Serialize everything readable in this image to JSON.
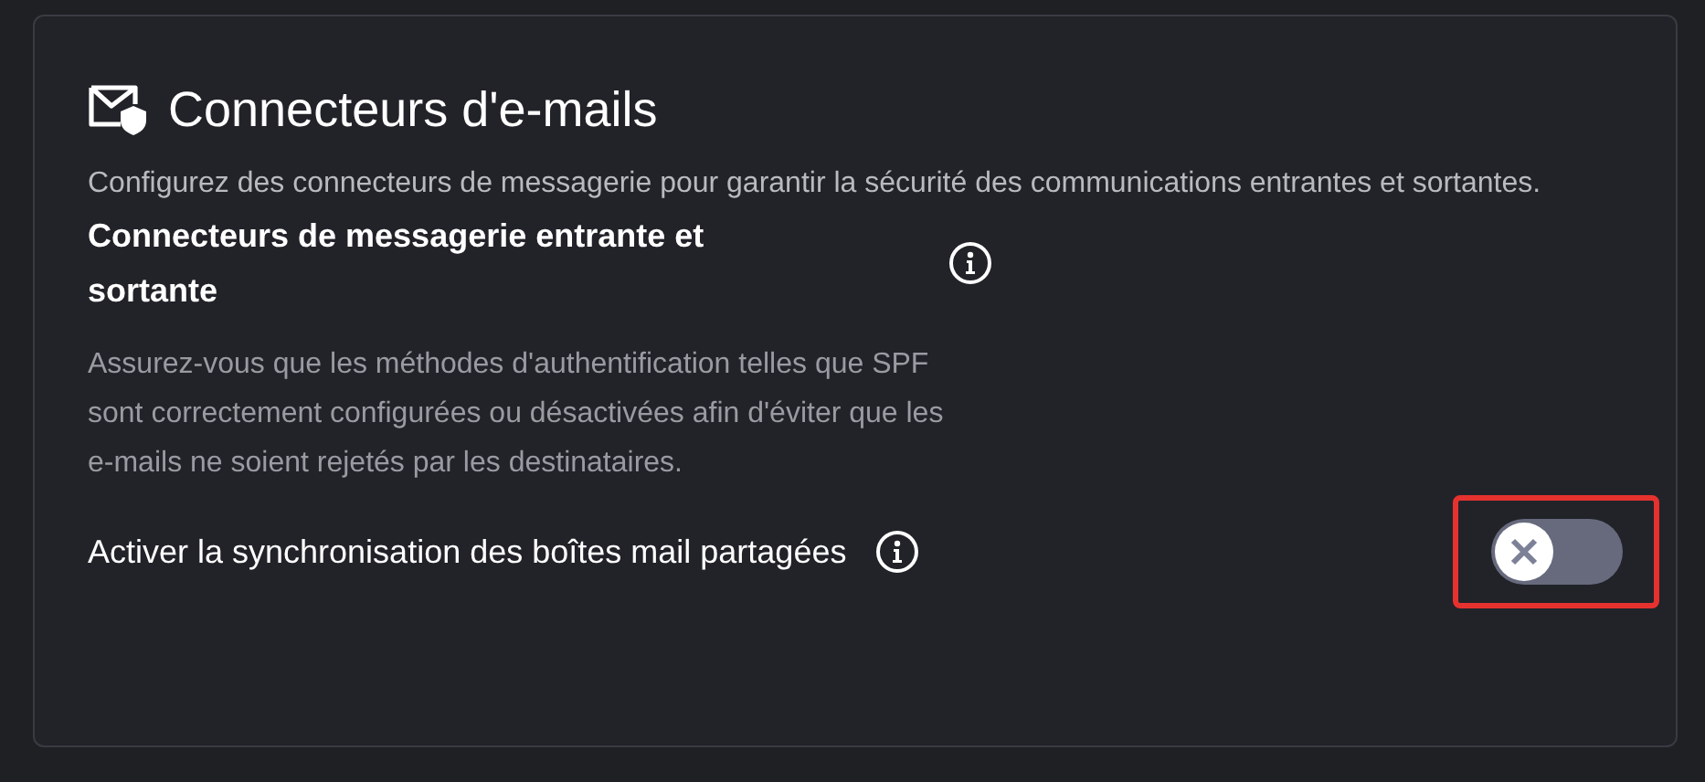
{
  "card": {
    "title": "Connecteurs d'e-mails",
    "description": "Configurez des connecteurs de messagerie pour garantir la sécurité des communications entrantes et sortantes.",
    "section": {
      "heading": "Connecteurs de messagerie entrante et sortante",
      "body": "Assurez-vous que les méthodes d'authentification telles que SPF sont correctement configurées ou désactivées afin d'éviter que les e-mails ne soient rejetés par les destinataires."
    },
    "setting": {
      "label": "Activer la synchronisation des boîtes mail partagées",
      "on": false,
      "highlighted": true
    }
  }
}
